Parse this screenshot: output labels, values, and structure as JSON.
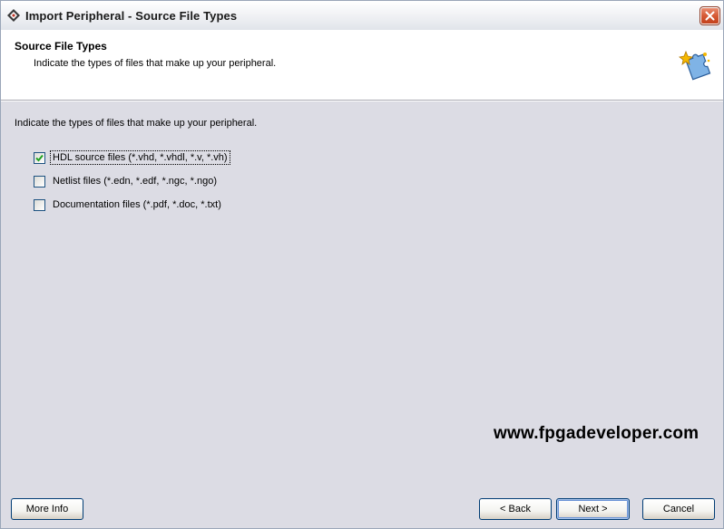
{
  "window": {
    "title": "Import Peripheral - Source File Types",
    "icon": "xilinx-logo-icon",
    "close_icon": "close-icon"
  },
  "header": {
    "title": "Source File Types",
    "subtitle": "Indicate the types of files that make up your peripheral.",
    "icon": "wizard-puzzle-icon"
  },
  "content": {
    "description": "Indicate the types of files that make up your peripheral.",
    "options": [
      {
        "label": "HDL source files (*.vhd, *.vhdl, *.v, *.vh)",
        "checked": true
      },
      {
        "label": "Netlist files (*.edn, *.edf, *.ngc, *.ngo)",
        "checked": false
      },
      {
        "label": "Documentation files (*.pdf, *.doc, *.txt)",
        "checked": false
      }
    ]
  },
  "watermark": "www.fpgadeveloper.com",
  "buttons": {
    "more_info": "More Info",
    "back": "< Back",
    "next": "Next >",
    "cancel": "Cancel"
  },
  "colors": {
    "accent": "#21a121",
    "close_button": "#d65a35",
    "button_border": "#003c74"
  }
}
